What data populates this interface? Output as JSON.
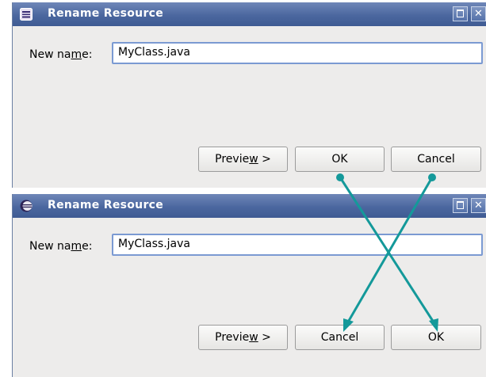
{
  "colors": {
    "arrow": "#14999a",
    "titlebar": "#4b679f",
    "dialog_bg": "#edeceb",
    "input_border": "#7b9ad2"
  },
  "dialog_before": {
    "title": "Rename Resource",
    "app_icon": "eclipse-icon",
    "maximize_icon": "maximize-icon",
    "close_icon": "close-icon",
    "close_glyph": "✕",
    "label_pre": "New na",
    "label_mnemonic": "m",
    "label_post": "e:",
    "name_value": "MyClass.java",
    "buttons": {
      "preview_pre": "Previe",
      "preview_mnemonic": "w",
      "preview_post": " >",
      "ok": "OK",
      "cancel": "Cancel"
    }
  },
  "dialog_after": {
    "title": "Rename Resource",
    "app_icon": "eclipse-icon",
    "maximize_icon": "maximize-icon",
    "close_icon": "close-icon",
    "close_glyph": "✕",
    "label_pre": "New na",
    "label_mnemonic": "m",
    "label_post": "e:",
    "name_value": "MyClass.java",
    "buttons": {
      "preview_pre": "Previe",
      "preview_mnemonic": "w",
      "preview_post": " >",
      "cancel": "Cancel",
      "ok": "OK"
    }
  }
}
